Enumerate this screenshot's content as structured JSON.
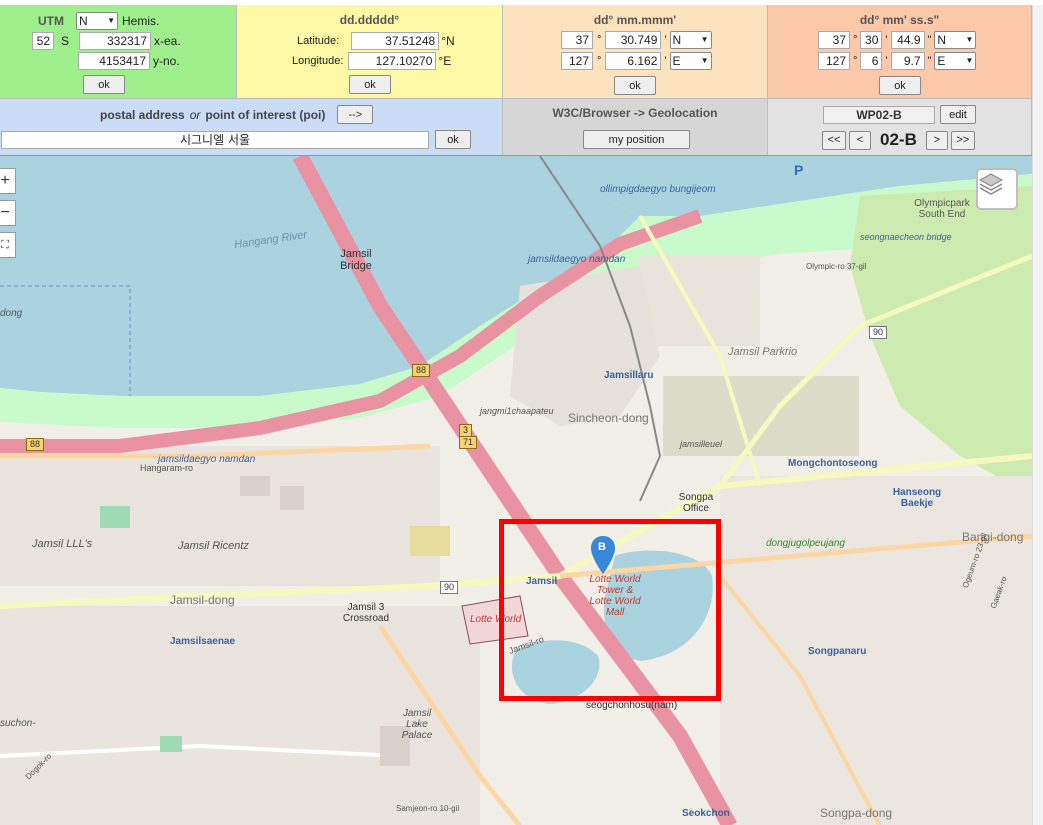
{
  "utm": {
    "title": "UTM",
    "hemis_select": "N",
    "hemis_label": "Hemis.",
    "zone": "52",
    "band": "S",
    "easting": "332317",
    "easting_label": "x-ea.",
    "northing": "4153417",
    "northing_label": "y-no.",
    "ok_label": "ok"
  },
  "decimal": {
    "title": "dd.ddddd°",
    "lat_label": "Latitude:",
    "lat_value": "37.51248",
    "lat_unit": "°N",
    "lon_label": "Longitude:",
    "lon_value": "127.10270",
    "lon_unit": "°E",
    "ok_label": "ok"
  },
  "dmm": {
    "title": "dd° mm.mmm'",
    "lat_deg": "37",
    "lat_min": "30.749",
    "lat_hemi": "N",
    "lon_deg": "127",
    "lon_min": "6.162",
    "lon_hemi": "E",
    "deg_sym": "°",
    "min_sym": "'",
    "ok_label": "ok"
  },
  "dms": {
    "title": "dd° mm' ss.s\"",
    "lat_deg": "37",
    "lat_min": "30",
    "lat_sec": "44.9",
    "lat_hemi": "N",
    "lon_deg": "127",
    "lon_min": "6",
    "lon_sec": "9.7",
    "lon_hemi": "E",
    "deg_sym": "°",
    "min_sym": "'",
    "sec_sym": "\"",
    "ok_label": "ok"
  },
  "address": {
    "title_prefix": "postal address",
    "title_or": "or",
    "title_suffix": "point of interest (poi)",
    "arrow_button": "-->",
    "value": "시그니엘 서울",
    "ok_label": "ok"
  },
  "geolocation": {
    "title": "W3C/Browser -> Geolocation",
    "button": "my position"
  },
  "waypoint": {
    "name": "WP02-B",
    "edit_label": "edit",
    "first_label": "<<",
    "prev_label": "<",
    "current": "02-B",
    "next_label": ">",
    "last_label": ">>"
  },
  "map": {
    "zoom_in": "+",
    "zoom_out": "−",
    "marker_letter": "B",
    "labels": {
      "hangang_river": "Hangang River",
      "jamsil_bridge": "Jamsil Bridge",
      "jamsildaegyo_namdan_top": "jamsildaegyo namdan",
      "jamsildaegyo_namdan_left": "jamsildaegyo namdan",
      "olympic_bridge_area": "ollimpigdaegyo bungijeom",
      "seongnae": "seongnaecheon bridge",
      "olympic_ro": "Olympic-ro 37-gil",
      "olympic_park_end": "Olympicpark South End",
      "jamsil_parkrio": "Jamsil Parkrio",
      "jamsillaru": "Jamsillaru",
      "jangmi": "jangmi1chaapateu",
      "sincheon_dong": "Sincheon-dong",
      "jamsilleuel": "jamsilleuel",
      "hangaram": "Hangaram-ro",
      "mongchontoseong": "Mongchontoseong",
      "hanseong_baekje": "Hanseong Baekje",
      "songpa_office": "Songpa Office",
      "dongjugolpeujang": "dongjugolpeujang",
      "bangi_dong": "Bangi-dong",
      "jamsil_lll": "Jamsil LLL's",
      "jamsil_ricentz": "Jamsil Ricentz",
      "jamsil": "Jamsil",
      "lotte_world_tower": "Lotte World Tower & Lotte World Mall",
      "jamsil_dong": "Jamsil-dong",
      "jamsil_3_crossroad": "Jamsil 3 Crossroad",
      "lotte_world": "Lotte World",
      "jamsilsaenae": "Jamsilsaenae",
      "jamsil_ro": "Jamsil-ro",
      "jamsil_lake_palace": "Jamsil Lake Palace",
      "seokchonhosu": "seogchonhosu(nam)",
      "songpanaru": "Songpanaru",
      "ogeum_ro": "Ogeum-ro 23-gil",
      "gaeak_ro": "Gaeak-ro",
      "dogok_ro": "Dogok-ro",
      "samjeon_ro": "Samjeon-ro 10-gil",
      "seokchon": "Seokchon",
      "songpa_dong": "Songpa-dong",
      "suchon": "suchon-",
      "dong": "dong"
    },
    "shields": {
      "s88_a": "88",
      "s88_b": "88",
      "s90_a": "90",
      "s90_b": "90",
      "s3": "3",
      "s71": "71"
    }
  },
  "colors": {
    "utm_bg": "#9fef8c",
    "decimal_bg": "#fdf8a6",
    "dmm_bg": "#fde3bd",
    "dms_bg": "#fbc9aa",
    "address_bg": "#cbdcf6",
    "highlight_box": "#ff0000",
    "marker": "#3a86d9",
    "water": "#aad3df",
    "motorway": "#e892a2"
  }
}
